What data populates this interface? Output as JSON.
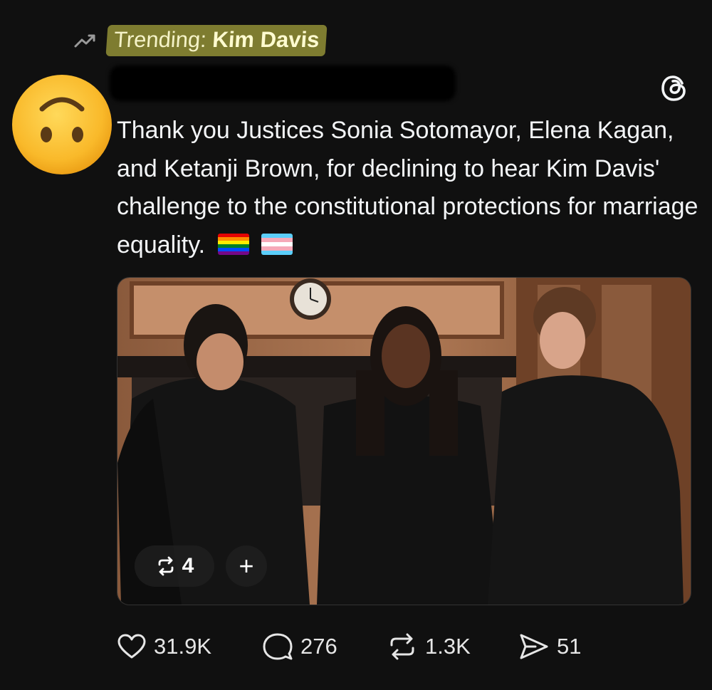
{
  "trending": {
    "prefix": "Trending:",
    "topic": "Kim Davis"
  },
  "post": {
    "text": "Thank you Justices Sonia Sotomayor, Elena Kagan, and Ketanji Brown, for declining to hear Kim Davis' challenge to the constitutional protections for marriage equality."
  },
  "media": {
    "repost_count": "4",
    "add_label": "+"
  },
  "actions": {
    "likes": "31.9K",
    "replies": "276",
    "reposts": "1.3K",
    "shares": "51"
  },
  "icons": [
    "trending-icon",
    "threads-logo-icon",
    "rainbow-flag-icon",
    "transgender-flag-icon",
    "repost-icon",
    "plus-icon",
    "heart-icon",
    "comment-icon",
    "share-icon"
  ],
  "colors": {
    "background": "#101010",
    "highlight": "#d8d54a",
    "text": "#f3f5f7"
  }
}
